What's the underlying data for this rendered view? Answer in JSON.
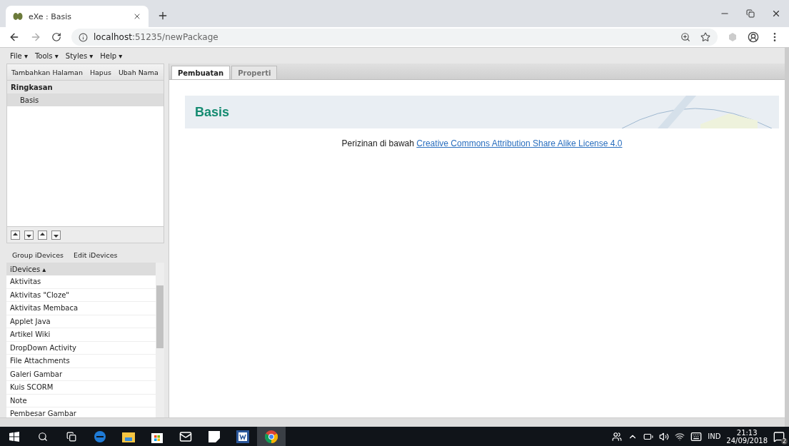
{
  "browser": {
    "tab": {
      "title": "eXe : Basis",
      "selected": true
    },
    "url_host": "localhost",
    "url_path": ":51235/newPackage"
  },
  "menu": [
    "File ▾",
    "Tools ▾",
    "Styles ▾",
    "Help ▾"
  ],
  "outline_toolbar": [
    "Tambahkan Halaman",
    "Hapus",
    "Ubah Nama"
  ],
  "outline": {
    "label": "Ringkasan",
    "children": [
      {
        "label": "Basis",
        "selected": true
      }
    ]
  },
  "idevice_tabs": [
    "Group iDevices",
    "Edit iDevices"
  ],
  "idevices": {
    "column": "iDevices ▴",
    "items": [
      "Aktivitas",
      "Aktivitas \"Cloze\"",
      "Aktivitas Membaca",
      "Applet Java",
      "Artikel Wiki",
      "DropDown Activity",
      "File Attachments",
      "Galeri Gambar",
      "Kuis SCORM",
      "Note",
      "Pembesar Gambar"
    ]
  },
  "content_tabs": [
    {
      "label": "Pembuatan",
      "selected": true
    },
    {
      "label": "Properti",
      "selected": false
    }
  ],
  "page": {
    "title": "Basis",
    "license_text": "Perizinan di bawah ",
    "license_link": "Creative Commons Attribution Share Alike License 4.0"
  },
  "taskbar": {
    "language": "IND",
    "time": "21:13",
    "date": "24/09/2018",
    "notifications": "2"
  }
}
